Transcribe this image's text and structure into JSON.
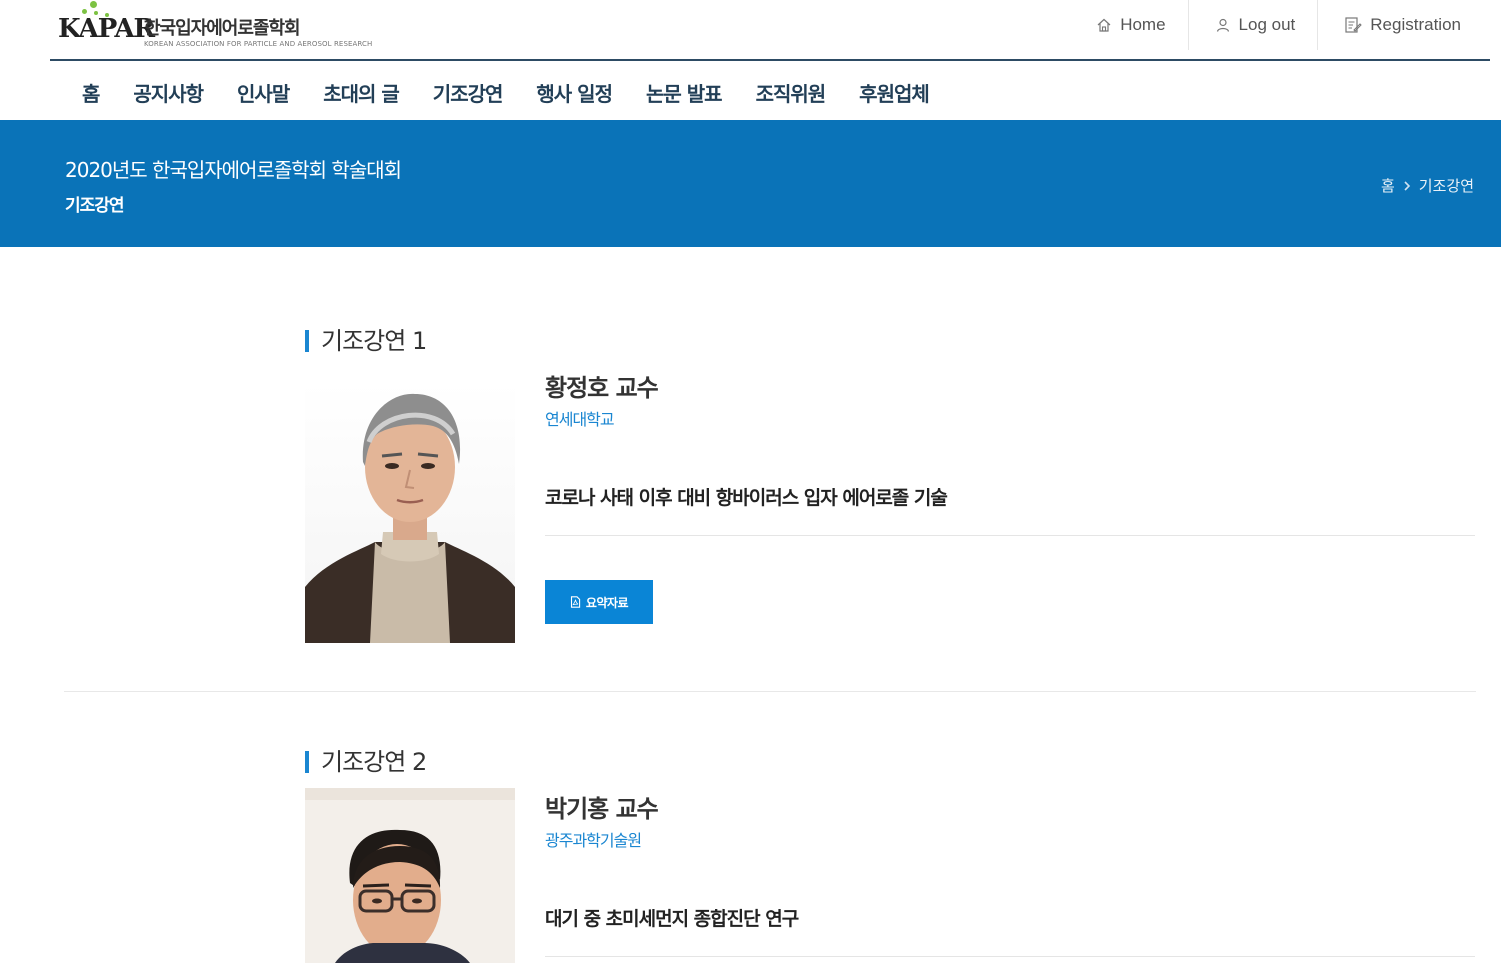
{
  "logo": {
    "mark": "KAPAR",
    "name_ko": "한국입자에어로졸학회",
    "name_en": "KOREAN ASSOCIATION FOR PARTICLE AND AEROSOL RESEARCH",
    "dot_color": "#7cc242"
  },
  "util_nav": [
    {
      "label": "Home",
      "icon": "home-icon"
    },
    {
      "label": "Log out",
      "icon": "user-icon"
    },
    {
      "label": "Registration",
      "icon": "registration-icon"
    }
  ],
  "main_nav": [
    "홈",
    "공지사항",
    "인사말",
    "초대의 글",
    "기조강연",
    "행사 일정",
    "논문 발표",
    "조직위원",
    "후원업체"
  ],
  "banner": {
    "title": "2020년도 한국입자에어로졸학회 학술대회",
    "subtitle": "기조강연",
    "breadcrumb": {
      "home": "홈",
      "current": "기조강연"
    },
    "bg_color": "#0a73b8"
  },
  "keynotes": [
    {
      "section_title": "기조강연 1",
      "speaker": "황정호 교수",
      "affiliation": "연세대학교",
      "talk_title": "코로나 사태 이후 대비 항바이러스 입자 에어로졸 기술",
      "button_label": "요약자료"
    },
    {
      "section_title": "기조강연 2",
      "speaker": "박기홍 교수",
      "affiliation": "광주과학기술원",
      "talk_title": "대기 중 초미세먼지 종합진단 연구"
    }
  ],
  "colors": {
    "accent": "#1a86d1",
    "nav_text": "#223f57",
    "button": "#0a85d6"
  }
}
